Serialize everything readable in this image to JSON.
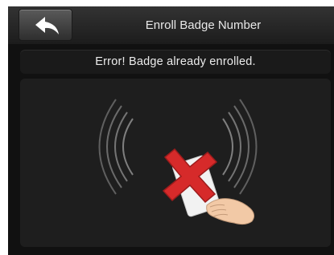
{
  "header": {
    "title": "Enroll Badge Number",
    "back_icon": "back-arrow-icon"
  },
  "message": {
    "text": "Error! Badge already enrolled."
  },
  "illustration": {
    "icons": [
      "rfid-waves-icon",
      "badge-card-icon",
      "hand-icon",
      "red-x-error-icon"
    ],
    "error_color": "#d62a2a"
  }
}
